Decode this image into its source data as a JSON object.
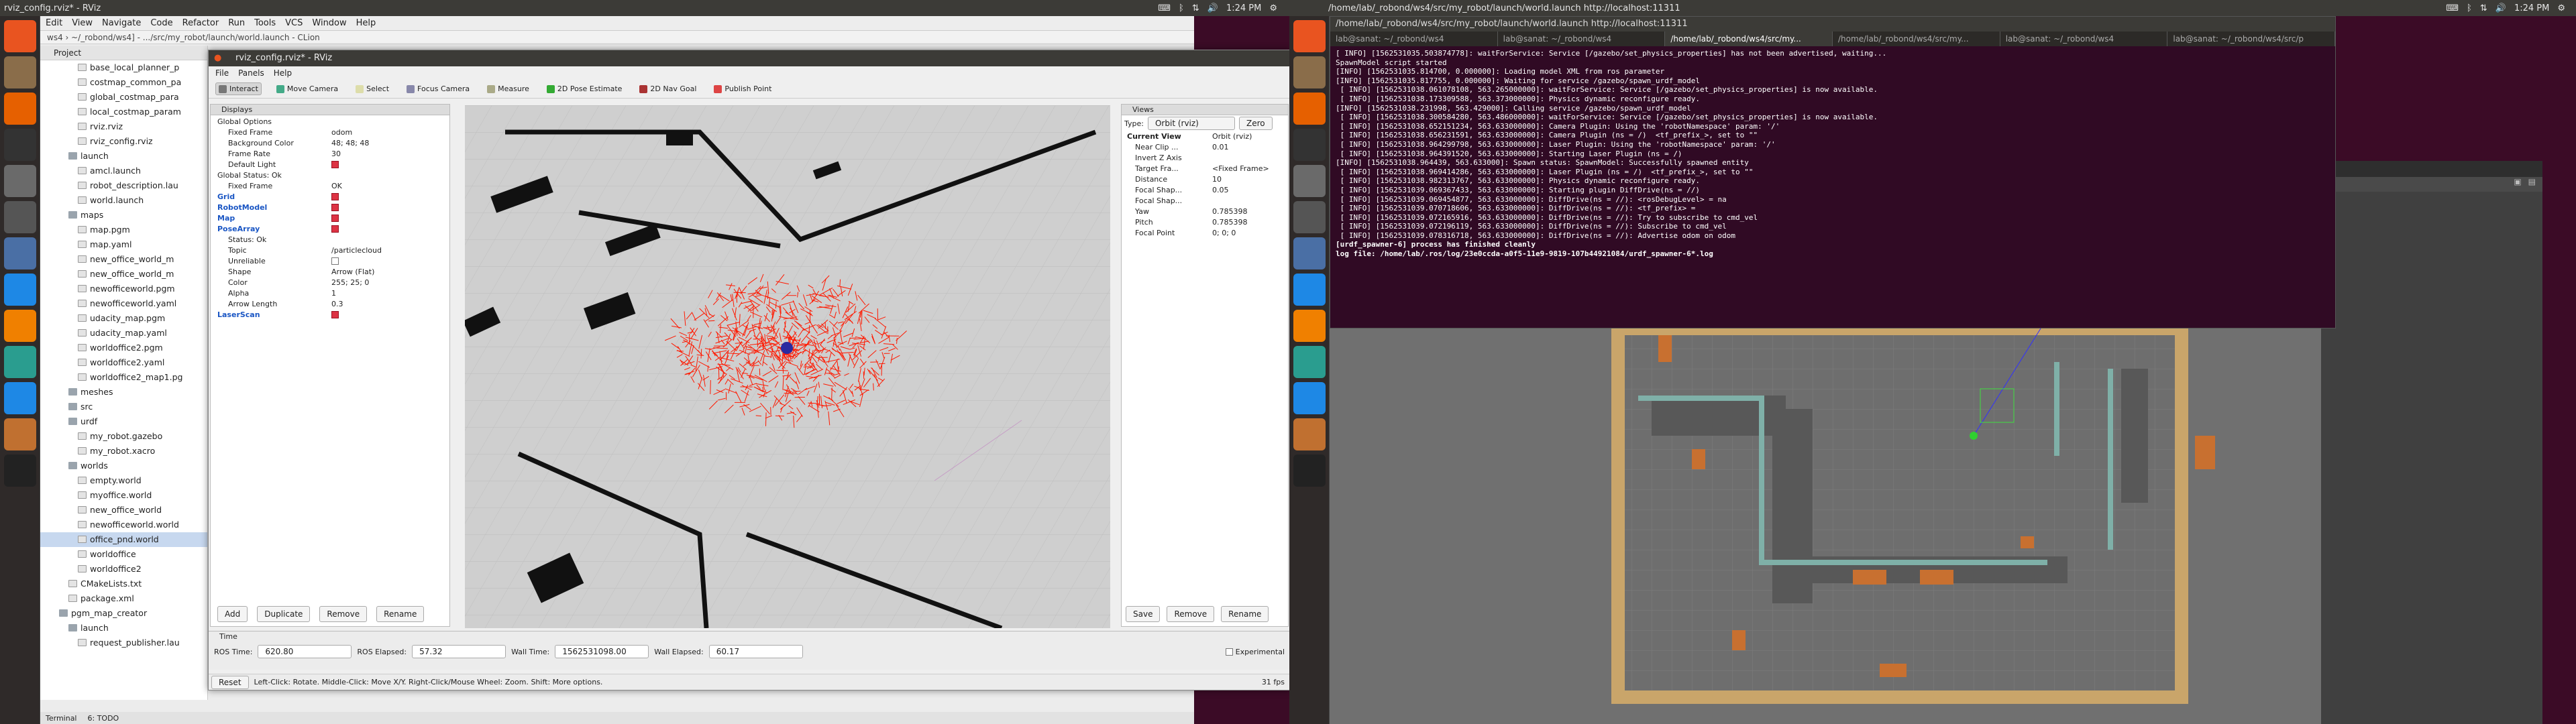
{
  "left_screen": {
    "topbar_title": "rviz_config.rviz* - RViz",
    "clock": "1:24 PM"
  },
  "right_screen": {
    "topbar_title": "/home/lab/_robond/ws4/src/my_robot/launch/world.launch http://localhost:11311",
    "clock": "1:24 PM"
  },
  "launcher_icons": [
    "ubuntu-dash",
    "files",
    "firefox",
    "terminal",
    "text-editor",
    "julia",
    "rviz",
    "chrome",
    "vlc",
    "libreoffice",
    "chrome",
    "gazebo",
    "clion"
  ],
  "clion": {
    "menu": [
      "Edit",
      "View",
      "Navigate",
      "Code",
      "Refactor",
      "Run",
      "Tools",
      "VCS",
      "Window",
      "Help"
    ],
    "breadcrumb": "ws4 › ~/_robond/ws4] - .../src/my_robot/launch/world.launch - CLion",
    "project_header": "Project",
    "tree": [
      {
        "label": "base_local_planner_p",
        "indent": 4,
        "type": "file"
      },
      {
        "label": "costmap_common_pa",
        "indent": 4,
        "type": "file"
      },
      {
        "label": "global_costmap_para",
        "indent": 4,
        "type": "file"
      },
      {
        "label": "local_costmap_param",
        "indent": 4,
        "type": "file"
      },
      {
        "label": "rviz.rviz",
        "indent": 4,
        "type": "file"
      },
      {
        "label": "rviz_config.rviz",
        "indent": 4,
        "type": "file"
      },
      {
        "label": "launch",
        "indent": 3,
        "type": "folder"
      },
      {
        "label": "amcl.launch",
        "indent": 4,
        "type": "file"
      },
      {
        "label": "robot_description.lau",
        "indent": 4,
        "type": "file"
      },
      {
        "label": "world.launch",
        "indent": 4,
        "type": "file"
      },
      {
        "label": "maps",
        "indent": 3,
        "type": "folder"
      },
      {
        "label": "map.pgm",
        "indent": 4,
        "type": "file"
      },
      {
        "label": "map.yaml",
        "indent": 4,
        "type": "file"
      },
      {
        "label": "new_office_world_m",
        "indent": 4,
        "type": "file"
      },
      {
        "label": "new_office_world_m",
        "indent": 4,
        "type": "file"
      },
      {
        "label": "newofficeworld.pgm",
        "indent": 4,
        "type": "file"
      },
      {
        "label": "newofficeworld.yaml",
        "indent": 4,
        "type": "file"
      },
      {
        "label": "udacity_map.pgm",
        "indent": 4,
        "type": "file"
      },
      {
        "label": "udacity_map.yaml",
        "indent": 4,
        "type": "file"
      },
      {
        "label": "worldoffice2.pgm",
        "indent": 4,
        "type": "file"
      },
      {
        "label": "worldoffice2.yaml",
        "indent": 4,
        "type": "file"
      },
      {
        "label": "worldoffice2_map1.pg",
        "indent": 4,
        "type": "file"
      },
      {
        "label": "meshes",
        "indent": 3,
        "type": "folder"
      },
      {
        "label": "src",
        "indent": 3,
        "type": "folder"
      },
      {
        "label": "urdf",
        "indent": 3,
        "type": "folder"
      },
      {
        "label": "my_robot.gazebo",
        "indent": 4,
        "type": "file"
      },
      {
        "label": "my_robot.xacro",
        "indent": 4,
        "type": "file"
      },
      {
        "label": "worlds",
        "indent": 3,
        "type": "folder"
      },
      {
        "label": "empty.world",
        "indent": 4,
        "type": "file"
      },
      {
        "label": "myoffice.world",
        "indent": 4,
        "type": "file"
      },
      {
        "label": "new_office_world",
        "indent": 4,
        "type": "file"
      },
      {
        "label": "newofficeworld.world",
        "indent": 4,
        "type": "file"
      },
      {
        "label": "office_pnd.world",
        "indent": 4,
        "type": "file",
        "selected": true
      },
      {
        "label": "worldoffice",
        "indent": 4,
        "type": "file"
      },
      {
        "label": "worldoffice2",
        "indent": 4,
        "type": "file"
      },
      {
        "label": "CMakeLists.txt",
        "indent": 3,
        "type": "file"
      },
      {
        "label": "package.xml",
        "indent": 3,
        "type": "file"
      },
      {
        "label": "pgm_map_creator",
        "indent": 2,
        "type": "folder"
      },
      {
        "label": "launch",
        "indent": 3,
        "type": "folder"
      },
      {
        "label": "request_publisher.lau",
        "indent": 4,
        "type": "file"
      }
    ],
    "bottom_tabs": [
      "Terminal",
      "6: TODO"
    ]
  },
  "rviz": {
    "title": "rviz_config.rviz* - RViz",
    "menu": [
      "File",
      "Panels",
      "Help"
    ],
    "tools": [
      "Interact",
      "Move Camera",
      "Select",
      "Focus Camera",
      "Measure",
      "2D Pose Estimate",
      "2D Nav Goal",
      "Publish Point"
    ],
    "displays": {
      "header": "Displays",
      "rows": [
        {
          "k": "Global Options",
          "v": "",
          "lvl": 0
        },
        {
          "k": "Fixed Frame",
          "v": "odom",
          "lvl": 1
        },
        {
          "k": "Background Color",
          "v": "48; 48; 48",
          "lvl": 1
        },
        {
          "k": "Frame Rate",
          "v": "30",
          "lvl": 1
        },
        {
          "k": "Default Light",
          "v": "",
          "lvl": 1,
          "check": true
        },
        {
          "k": "Global Status: Ok",
          "v": "",
          "lvl": 0
        },
        {
          "k": "Fixed Frame",
          "v": "OK",
          "lvl": 1
        },
        {
          "k": "Grid",
          "v": "",
          "lvl": 0,
          "check": true,
          "blue": true
        },
        {
          "k": "RobotModel",
          "v": "",
          "lvl": 0,
          "check": true,
          "blue": true
        },
        {
          "k": "Map",
          "v": "",
          "lvl": 0,
          "check": true,
          "blue": true
        },
        {
          "k": "PoseArray",
          "v": "",
          "lvl": 0,
          "check": true,
          "blue": true
        },
        {
          "k": "Status: Ok",
          "v": "",
          "lvl": 1
        },
        {
          "k": "Topic",
          "v": "/particlecloud",
          "lvl": 1
        },
        {
          "k": "Unreliable",
          "v": "",
          "lvl": 1,
          "check": false
        },
        {
          "k": "Shape",
          "v": "Arrow (Flat)",
          "lvl": 1
        },
        {
          "k": "Color",
          "v": "255; 25; 0",
          "lvl": 1
        },
        {
          "k": "Alpha",
          "v": "1",
          "lvl": 1
        },
        {
          "k": "Arrow Length",
          "v": "0.3",
          "lvl": 1
        },
        {
          "k": "LaserScan",
          "v": "",
          "lvl": 0,
          "check": true,
          "blue": true
        }
      ],
      "buttons": [
        "Add",
        "Duplicate",
        "Remove",
        "Rename"
      ]
    },
    "views": {
      "header": "Views",
      "type_label": "Type:",
      "type_value": "Orbit (rviz)",
      "zero": "Zero",
      "rows": [
        {
          "k": "Current View",
          "v": "Orbit (rviz)"
        },
        {
          "k": "Near Clip ...",
          "v": "0.01"
        },
        {
          "k": "Invert Z Axis",
          "v": ""
        },
        {
          "k": "Target Fra...",
          "v": "<Fixed Frame>"
        },
        {
          "k": "Distance",
          "v": "10"
        },
        {
          "k": "Focal Shap...",
          "v": "0.05"
        },
        {
          "k": "Focal Shap...",
          "v": ""
        },
        {
          "k": "Yaw",
          "v": "0.785398"
        },
        {
          "k": "Pitch",
          "v": "0.785398"
        },
        {
          "k": "Focal Point",
          "v": "0; 0; 0"
        }
      ],
      "buttons": [
        "Save",
        "Remove",
        "Rename"
      ]
    },
    "time": {
      "header": "Time",
      "ros_time_label": "ROS Time:",
      "ros_time": "620.80",
      "ros_elapsed_label": "ROS Elapsed:",
      "ros_elapsed": "57.32",
      "wall_time_label": "Wall Time:",
      "wall_time": "1562531098.00",
      "wall_elapsed_label": "Wall Elapsed:",
      "wall_elapsed": "60.17",
      "experimental": "Experimental"
    },
    "status": {
      "reset": "Reset",
      "help": "Left-Click: Rotate. Middle-Click: Move X/Y. Right-Click/Mouse Wheel: Zoom. Shift: More options.",
      "fps": "31 fps"
    }
  },
  "terminal": {
    "title": "/home/lab/_robond/ws4/src/my_robot/launch/world.launch http://localhost:11311",
    "tabs": [
      "lab@sanat: ~/_robond/ws4",
      "lab@sanat: ~/_robond/ws4",
      "/home/lab/_robond/ws4/src/my...",
      "/home/lab/_robond/ws4/src/my...",
      "lab@sanat: ~/_robond/ws4",
      "lab@sanat: ~/_robond/ws4/src/p"
    ],
    "lines": [
      "[ INFO] [1562531035.503874778]: waitForService: Service [/gazebo/set_physics_properties] has not been advertised, waiting...",
      "SpawnModel script started",
      "[INFO] [1562531035.814700, 0.000000]: Loading model XML from ros parameter",
      "[INFO] [1562531035.817755, 0.000000]: Waiting for service /gazebo/spawn_urdf_model",
      " [ INFO] [1562531038.061078108, 563.265000000]: waitForService: Service [/gazebo/set_physics_properties] is now available.",
      " [ INFO] [1562531038.173309588, 563.373000000]: Physics dynamic reconfigure ready.",
      "[INFO] [1562531038.231998, 563.429000]: Calling service /gazebo/spawn_urdf_model",
      " [ INFO] [1562531038.300584280, 563.486000000]: waitForService: Service [/gazebo/set_physics_properties] is now available.",
      " [ INFO] [1562531038.652151234, 563.633000000]: Camera Plugin: Using the 'robotNamespace' param: '/'",
      " [ INFO] [1562531038.656231591, 563.633000000]: Camera Plugin (ns = /)  <tf_prefix_>, set to \"\"",
      " [ INFO] [1562531038.964299798, 563.633000000]: Laser Plugin: Using the 'robotNamespace' param: '/'",
      " [ INFO] [1562531038.964391520, 563.633000000]: Starting Laser Plugin (ns = /)",
      "[INFO] [1562531038.964439, 563.633000]: Spawn status: SpawnModel: Successfully spawned entity",
      " [ INFO] [1562531038.969414286, 563.633000000]: Laser Plugin (ns = /)  <tf_prefix_>, set to \"\"",
      " [ INFO] [1562531038.982313767, 563.633000000]: Physics dynamic reconfigure ready.",
      " [ INFO] [1562531039.069367433, 563.633000000]: Starting plugin DiffDrive(ns = //)",
      " [ INFO] [1562531039.069454877, 563.633000000]: DiffDrive(ns = //): <rosDebugLevel> = na",
      " [ INFO] [1562531039.070718606, 563.633000000]: DiffDrive(ns = //): <tf_prefix> =",
      " [ INFO] [1562531039.072165916, 563.633000000]: DiffDrive(ns = //): Try to subscribe to cmd_vel",
      " [ INFO] [1562531039.072196119, 563.633000000]: DiffDrive(ns = //): Subscribe to cmd_vel",
      " [ INFO] [1562531039.078316718, 563.633000000]: DiffDrive(ns = //): Advertise odom on odom",
      "[urdf_spawner-6] process has finished cleanly",
      "log file: /home/lab/.ros/log/23e0ccda-a0f5-11e9-9819-107b44921084/urdf_spawner-6*.log"
    ]
  },
  "colors": {
    "ubuntu_bg": "#3b0b26",
    "terminal_bg": "#300a24",
    "particles": "#ff1900"
  }
}
